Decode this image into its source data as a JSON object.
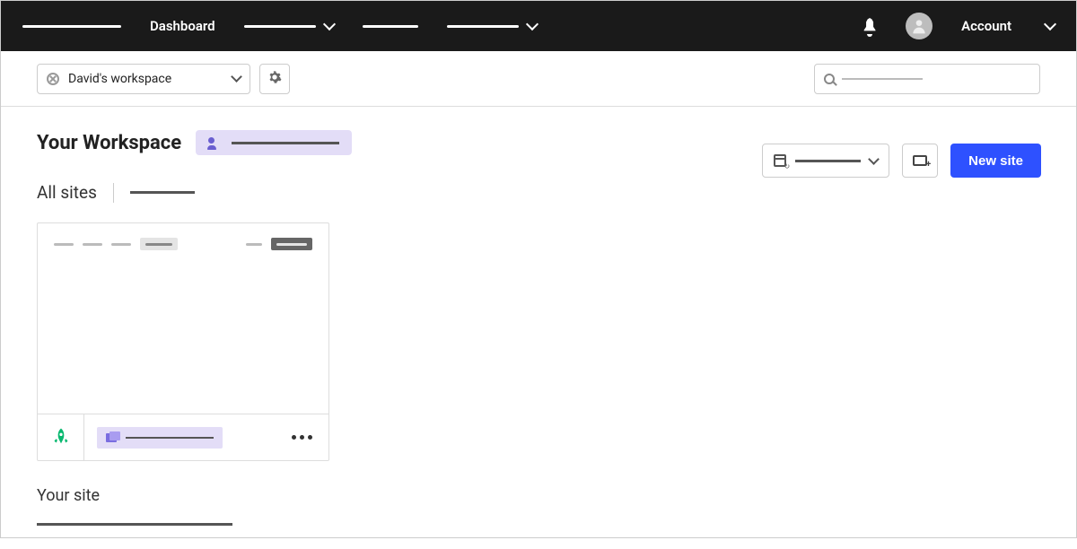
{
  "nav": {
    "active": "Dashboard",
    "account_label": "Account"
  },
  "subbar": {
    "workspace_name": "David's workspace",
    "search_placeholder": "Search"
  },
  "workspace": {
    "title": "Your Workspace"
  },
  "sites": {
    "title": "All sites",
    "actions": {
      "new_site": "New site"
    }
  },
  "section2": {
    "title": "Your site"
  },
  "colors": {
    "primary": "#2e51ff",
    "accent_bg": "#e3ddf7",
    "rocket": "#08b86f"
  }
}
